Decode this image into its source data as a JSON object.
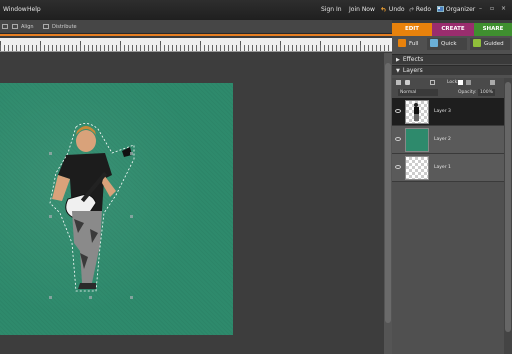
{
  "menubar": {
    "items": [
      "Window",
      "Help"
    ],
    "sign_in": "Sign In",
    "join_now": "Join Now",
    "undo": "Undo",
    "redo": "Redo",
    "organizer": "Organizer",
    "window_controls": [
      "–",
      "▫",
      "×"
    ]
  },
  "options_bar": {
    "move_label": "",
    "align_label": "Align",
    "distribute_label": "Distribute"
  },
  "modes": {
    "edit": "EDIT",
    "create": "CREATE",
    "share": "SHARE",
    "colors": {
      "edit": "#e8820c",
      "create": "#9a2d6e",
      "share": "#3f8f2f"
    }
  },
  "views": {
    "full": "Full",
    "quick": "Quick",
    "guided": "Guided"
  },
  "panels": {
    "effects": "Effects",
    "layers": "Layers",
    "blend_mode": "Normal",
    "opacity_label": "Opacity:",
    "opacity_value": "100%",
    "lock_label": "Lock:"
  },
  "layers": [
    {
      "name": "Layer 3",
      "selected": true,
      "thumb": "guitarist"
    },
    {
      "name": "Layer 2",
      "selected": false,
      "thumb": "green"
    },
    {
      "name": "Layer 1",
      "selected": false,
      "thumb": "transparent"
    }
  ],
  "icons": [
    "undo-icon",
    "redo-icon",
    "organizer-icon",
    "eye-icon",
    "lock-icon",
    "trash-icon",
    "new-layer-icon"
  ],
  "accent": "#e67e22"
}
